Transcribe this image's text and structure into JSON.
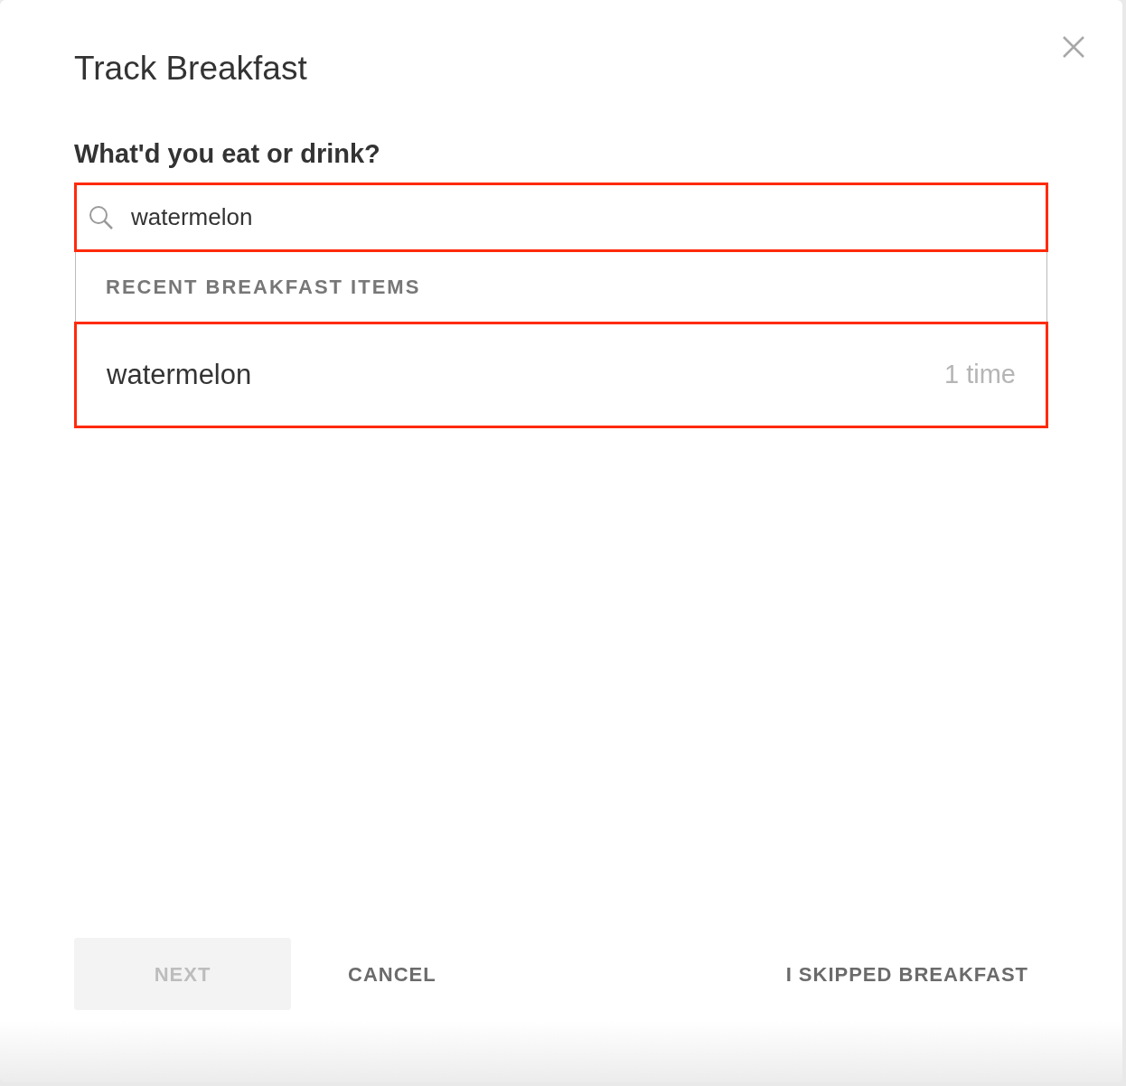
{
  "dialog": {
    "title": "Track Breakfast"
  },
  "question": "What'd you eat or drink?",
  "search": {
    "value": "watermelon",
    "highlighted": true
  },
  "suggestions": {
    "header": "RECENT BREAKFAST ITEMS",
    "items": [
      {
        "label": "watermelon",
        "count": "1 time",
        "highlighted": true
      }
    ]
  },
  "buttons": [
    {
      "label": "NEXT",
      "kind": "filled",
      "disabled": true
    },
    {
      "label": "CANCEL",
      "kind": "text",
      "disabled": false
    },
    {
      "label": "I SKIPPED BREAKFAST",
      "kind": "text",
      "disabled": false
    }
  ]
}
